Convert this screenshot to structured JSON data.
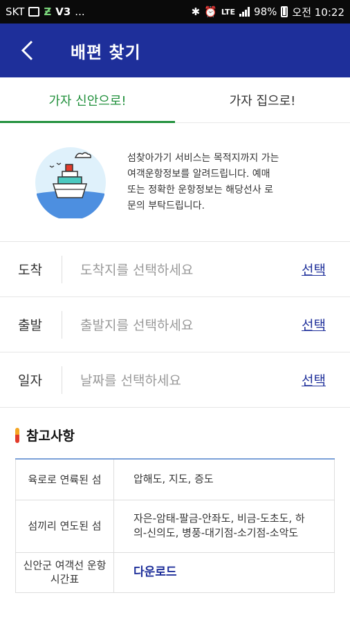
{
  "status_bar": {
    "carrier": "SKT",
    "dots": "...",
    "lte": "LTE",
    "battery": "98%",
    "time": "오전 10:22"
  },
  "app_bar": {
    "title": "배편 찾기"
  },
  "tabs": [
    {
      "label": "가자 신안으로!",
      "active": true
    },
    {
      "label": "가자 집으로!",
      "active": false
    }
  ],
  "intro": {
    "line1": "섬찾아가기 서비스는 목적지까지 가는",
    "line2": "여객운항정보를 알려드립니다.  예매",
    "line3": "또는 정확한 운항정보는 해당선사 로",
    "line4": "문의 부탁드립니다."
  },
  "fields": [
    {
      "label": "도착",
      "placeholder": "도착지를 선택하세요",
      "action": "선택"
    },
    {
      "label": "출발",
      "placeholder": "출발지를 선택하세요",
      "action": "선택"
    },
    {
      "label": "일자",
      "placeholder": "날짜를 선택하세요",
      "action": "선택"
    }
  ],
  "notice": {
    "title": "참고사항",
    "rows": [
      {
        "key": "육로로 연륙된 섬",
        "value": "압해도, 지도, 증도"
      },
      {
        "key": "섬끼리 연도된 섬",
        "value": "자은-암태-팔금-안좌도, 비금-도초도, 하의-신의도, 병풍-대기점-소기점-소악도"
      },
      {
        "key": "신안군 여객선 운항 시간표",
        "value": "다운로드"
      }
    ]
  },
  "colors": {
    "appbar": "#1e2f9a",
    "active_tab": "#1f8f3a",
    "link": "#1e2f9a"
  }
}
